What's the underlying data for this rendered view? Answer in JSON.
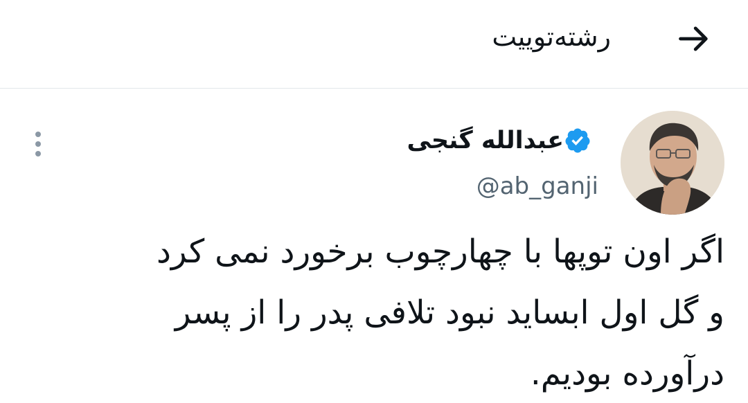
{
  "header": {
    "title": "رشته‌توییت",
    "back_icon": "arrow-right-icon"
  },
  "tweet": {
    "author": {
      "display_name": "عبدالله گنجی",
      "handle": "@ab_ganji",
      "verified": true,
      "verified_icon": "verified-badge-icon",
      "verified_color": "#1d9bf0"
    },
    "more_icon": "more-vertical-icon",
    "text": "اگر اون توپها با چهارچوب برخورد نمی کرد\nو گل اول ابساید نبود تلافی پدر را از پسر\nدرآورده بودیم."
  }
}
